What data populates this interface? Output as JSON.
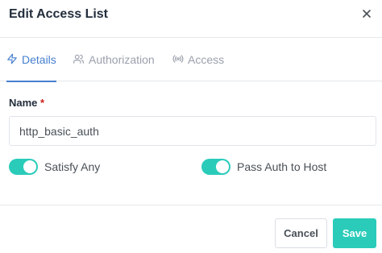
{
  "modal": {
    "title": "Edit Access List",
    "close_icon": "close-icon"
  },
  "tabs": [
    {
      "label": "Details",
      "icon": "lightning-icon",
      "active": true
    },
    {
      "label": "Authorization",
      "icon": "users-icon",
      "active": false
    },
    {
      "label": "Access",
      "icon": "broadcast-icon",
      "active": false
    }
  ],
  "form": {
    "name_label": "Name",
    "required_marker": "*",
    "name_value": "http_basic_auth",
    "toggles": [
      {
        "label": "Satisfy Any",
        "on": true
      },
      {
        "label": "Pass Auth to Host",
        "on": true
      }
    ]
  },
  "footer": {
    "cancel_label": "Cancel",
    "save_label": "Save"
  },
  "colors": {
    "accent": "#467fcf",
    "teal": "#2bcbba",
    "required": "#cd201f"
  }
}
